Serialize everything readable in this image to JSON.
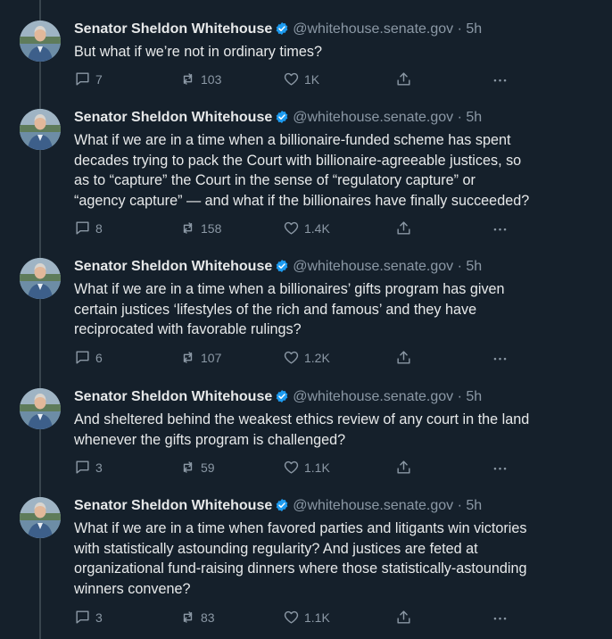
{
  "author": {
    "name": "Senator Sheldon Whitehouse",
    "handle": "@whitehouse.senate.gov",
    "separator": "·",
    "verified_icon": "verified-badge-icon",
    "verified_color": "#1d9bf0"
  },
  "tweets": [
    {
      "time": "5h",
      "text": "But what if we’re not in ordinary times?",
      "replies": "7",
      "reposts": "103",
      "likes": "1K"
    },
    {
      "time": "5h",
      "text": "What if we are in a time when a billionaire-funded scheme has spent\ndecades trying to pack the Court with billionaire-agreeable justices, so\nas to “capture” the Court in the sense of “regulatory capture” or\n“agency capture” — and what if the billionaires have finally succeeded?",
      "replies": "8",
      "reposts": "158",
      "likes": "1.4K"
    },
    {
      "time": "5h",
      "text": "What if we are in a time when a billionaires’ gifts program has given\ncertain justices ‘lifestyles of the rich and famous’ and they have\nreciprocated with favorable rulings?",
      "replies": "6",
      "reposts": "107",
      "likes": "1.2K"
    },
    {
      "time": "5h",
      "text": "And sheltered behind the weakest ethics review of any court in the land\nwhenever the gifts program is challenged?",
      "replies": "3",
      "reposts": "59",
      "likes": "1.1K"
    },
    {
      "time": "5h",
      "text": "What if we are in a time when favored parties and litigants win victories\nwith statistically astounding regularity? And justices are feted at\norganizational fund-raising dinners where those statistically-astounding\nwinners convene?",
      "replies": "3",
      "reposts": "83",
      "likes": "1.1K"
    }
  ],
  "icons": {
    "reply": "reply-icon",
    "repost": "repost-icon",
    "like": "heart-icon",
    "share": "share-icon",
    "more": "more-icon"
  },
  "colors": {
    "background": "#15202b",
    "text": "#e7e9ea",
    "muted": "#8b98a5",
    "thread_line": "#38444d"
  }
}
